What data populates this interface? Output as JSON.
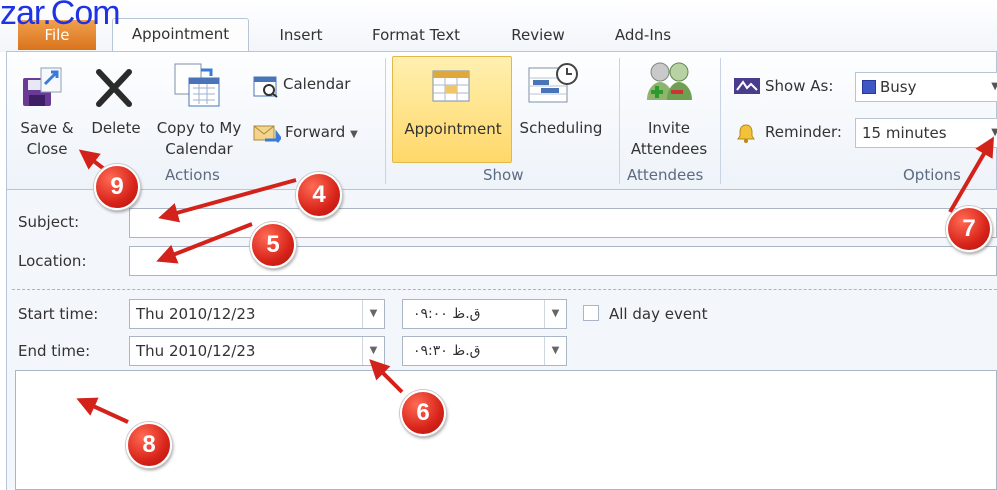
{
  "watermark": "zar.Com",
  "tabs": {
    "file": "File",
    "appointment": "Appointment",
    "insert": "Insert",
    "format_text": "Format Text",
    "review": "Review",
    "add_ins": "Add-Ins"
  },
  "ribbon": {
    "actions": {
      "save_close": "Save &\nClose",
      "delete": "Delete",
      "copy_calendar": "Copy to My\nCalendar",
      "calendar": "Calendar",
      "forward": "Forward",
      "group": "Actions"
    },
    "show": {
      "appointment": "Appointment",
      "scheduling": "Scheduling",
      "group": "Show"
    },
    "attendees": {
      "invite": "Invite\nAttendees",
      "group": "Attendees"
    },
    "options": {
      "show_as_label": "Show As:",
      "show_as_value": "Busy",
      "reminder_label": "Reminder:",
      "reminder_value": "15 minutes",
      "group": "Options"
    }
  },
  "form": {
    "subject_label": "Subject:",
    "location_label": "Location:",
    "start_label": "Start time:",
    "start_date": "Thu 2010/12/23",
    "start_time": "۰۹:۰۰ ق.ظ",
    "end_label": "End time:",
    "end_date": "Thu 2010/12/23",
    "end_time": "۰۹:۳۰ ق.ظ",
    "all_day": "All day event"
  },
  "annotations": [
    "9",
    "4",
    "5",
    "7",
    "6",
    "8"
  ],
  "colors": {
    "accent_orange": "#e07b27",
    "highlight": "#ffd86a",
    "busy": "#3e57c4",
    "badge_red": "#d8241a",
    "arrow_red": "#d3221a"
  }
}
